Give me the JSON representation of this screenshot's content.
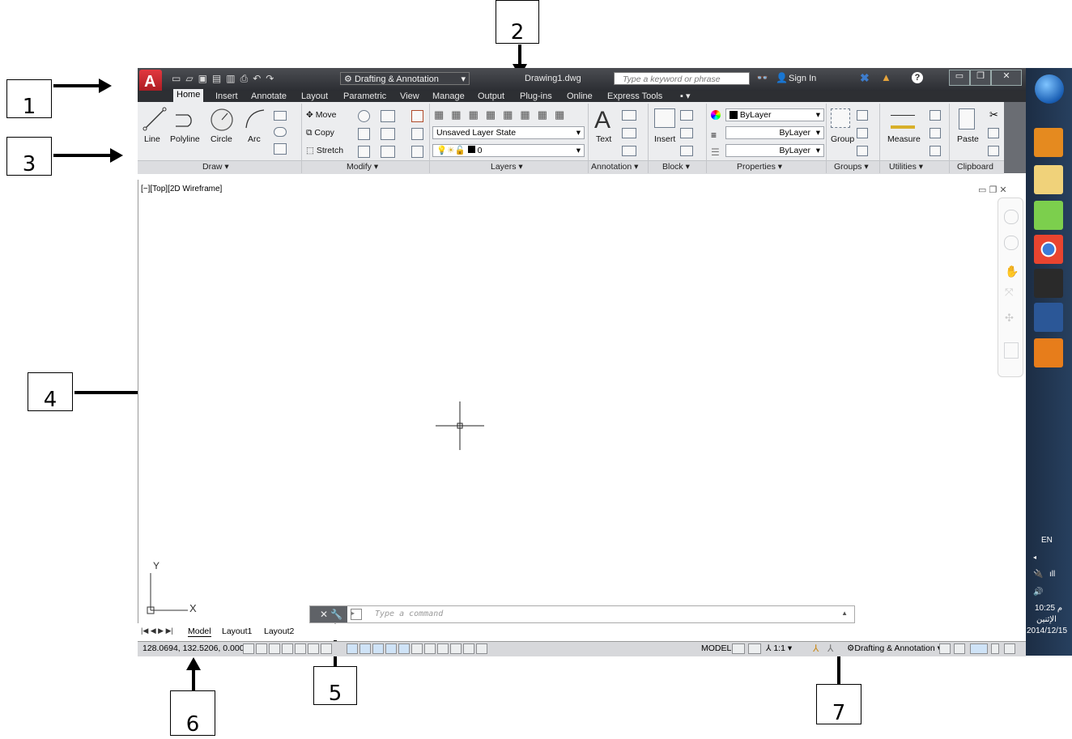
{
  "callouts": [
    "1",
    "2",
    "3",
    "4",
    "5",
    "6",
    "7"
  ],
  "titlebar": {
    "workspace": "Drafting & Annotation",
    "filename": "Drawing1.dwg",
    "search_placeholder": "Type a keyword or phrase",
    "sign_in": "Sign In"
  },
  "ribbon_tabs": [
    "Home",
    "Insert",
    "Annotate",
    "Layout",
    "Parametric",
    "View",
    "Manage",
    "Output",
    "Plug-ins",
    "Online",
    "Express Tools"
  ],
  "draw": {
    "line": "Line",
    "polyline": "Polyline",
    "circle": "Circle",
    "arc": "Arc",
    "title": "Draw ▾"
  },
  "modify": {
    "move": "Move",
    "copy": "Copy",
    "stretch": "Stretch",
    "title": "Modify ▾"
  },
  "layers": {
    "state": "Unsaved Layer State",
    "current": "0",
    "title": "Layers ▾"
  },
  "annotation": {
    "text": "Text",
    "title": "Annotation ▾"
  },
  "block": {
    "insert": "Insert",
    "title": "Block ▾"
  },
  "properties": {
    "color": "ByLayer",
    "lineweight": "ByLayer",
    "linetype": "ByLayer",
    "title": "Properties ▾"
  },
  "groups": {
    "group": "Group",
    "title": "Groups ▾"
  },
  "utilities": {
    "measure": "Measure",
    "title": "Utilities ▾"
  },
  "clipboard": {
    "paste": "Paste",
    "title": "Clipboard"
  },
  "viewport": {
    "label": "[−][Top][2D Wireframe]",
    "ucs_x": "X",
    "ucs_y": "Y"
  },
  "command": {
    "placeholder": "Type a command"
  },
  "layout_tabs": [
    "Model",
    "Layout1",
    "Layout2"
  ],
  "status": {
    "coords": "128.0694, 132.5206, 0.0000",
    "model": "MODEL",
    "scale": "1:1 ▾",
    "workspace": "Drafting & Annotation ▾"
  },
  "taskbar": {
    "lang": "EN",
    "time": "10:25 م",
    "day": "الإثنين",
    "date": "2014/12/15"
  },
  "colors": {
    "accent": "#c0262d",
    "titlebar": "#3a3c41",
    "ribbon": "#ecedef",
    "taskbar": "#22364f"
  }
}
